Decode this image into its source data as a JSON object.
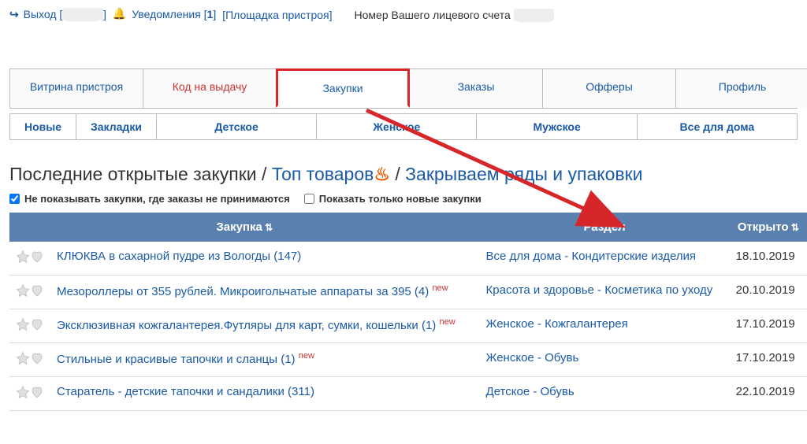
{
  "top": {
    "exit": "Выход",
    "user_masked": "████",
    "notifications": "Уведомления",
    "notif_count": "1",
    "platform": "[Площадка пристроя]",
    "account_label": "Номер Вашего лицевого счета",
    "account_masked": "████"
  },
  "tabs": [
    {
      "label": "Витрина пристроя"
    },
    {
      "label": "Код на выдачу",
      "red": true
    },
    {
      "label": "Закупки",
      "active": true
    },
    {
      "label": "Заказы"
    },
    {
      "label": "Офферы"
    },
    {
      "label": "Профиль"
    }
  ],
  "subtabs": [
    "Новые",
    "Закладки",
    "Детское",
    "Женское",
    "Мужское",
    "Все для дома"
  ],
  "heading": {
    "p1": "Последние открытые закупки / ",
    "link_top": "Топ товаров",
    "p2": " / ",
    "link_close": "Закрываем ряды и упаковки"
  },
  "filters": {
    "cb1": "Не показывать закупки, где заказы не принимаются",
    "cb2": "Показать только новые закупки"
  },
  "table": {
    "col_zakupka": "Закупка",
    "col_section": "Раздел",
    "col_open": "Открыто"
  },
  "rows": [
    {
      "title": "КЛЮКВА в сахарной пудре из Вологды (147)",
      "new": false,
      "section": "Все для дома - Кондитерские изделия",
      "date": "18.10.2019"
    },
    {
      "title": "Мезороллеры от 355 рублей. Микроигольчатые аппараты за 395 (4)",
      "new": true,
      "section": "Красота и здоровье - Косметика по уходу",
      "date": "20.10.2019"
    },
    {
      "title": "Эксклюзивная кожгалантерея.Футляры для карт, сумки, кошельки (1)",
      "new": true,
      "section": "Женское - Кожгалантерея",
      "date": "17.10.2019"
    },
    {
      "title": "Стильные и красивые тапочки и сланцы (1)",
      "new": true,
      "section": "Женское - Обувь",
      "date": "17.10.2019"
    },
    {
      "title": "Старатель - детские тапочки и сандалики (311)",
      "new": false,
      "section": "Детское - Обувь",
      "date": "22.10.2019"
    }
  ]
}
